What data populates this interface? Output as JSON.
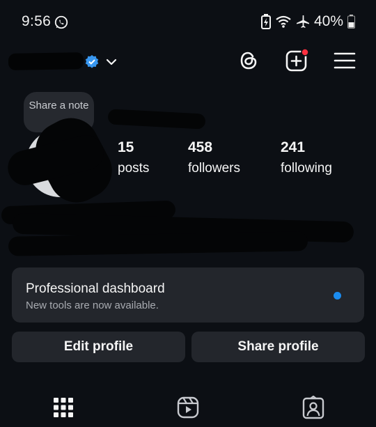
{
  "status_bar": {
    "time": "9:56",
    "battery_percent": "40%",
    "icons": [
      "whatsapp-icon",
      "battery-saver-icon",
      "wifi-icon",
      "airplane-icon",
      "battery-icon"
    ]
  },
  "top_nav": {
    "icons": [
      "verified-badge-icon",
      "chevron-down-icon",
      "threads-icon",
      "create-post-icon",
      "hamburger-menu-icon"
    ],
    "notification_dot_color": "#ff3040"
  },
  "note": {
    "text": "Share a note"
  },
  "stats": [
    {
      "value": "15",
      "label": "posts"
    },
    {
      "value": "458",
      "label": "followers"
    },
    {
      "value": "241",
      "label": "following"
    }
  ],
  "dashboard": {
    "title": "Professional dashboard",
    "subtitle": "New tools are now available.",
    "dot_color": "#1a8cf0"
  },
  "buttons": {
    "edit_profile": "Edit profile",
    "share_profile": "Share profile"
  },
  "tabs": [
    "grid-icon",
    "reels-icon",
    "tagged-icon"
  ],
  "colors": {
    "background": "#0c0f14",
    "surface": "#23262c",
    "accent": "#1a8cf0"
  }
}
